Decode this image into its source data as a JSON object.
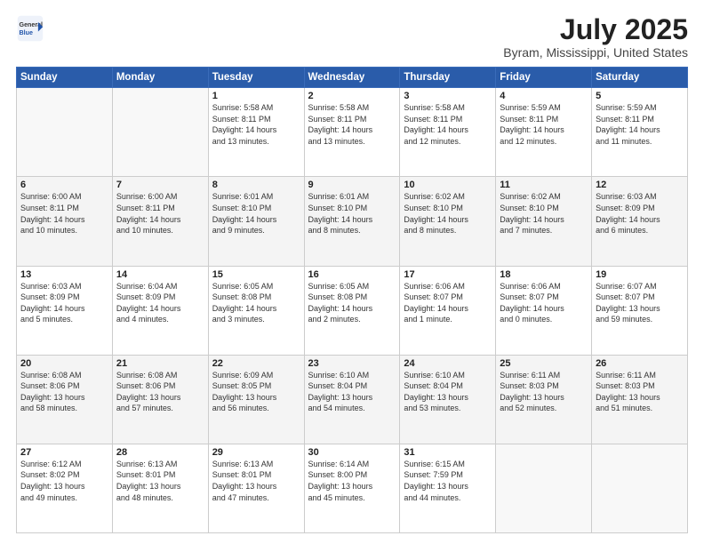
{
  "header": {
    "logo_general": "General",
    "logo_blue": "Blue",
    "month_year": "July 2025",
    "location": "Byram, Mississippi, United States"
  },
  "weekdays": [
    "Sunday",
    "Monday",
    "Tuesday",
    "Wednesday",
    "Thursday",
    "Friday",
    "Saturday"
  ],
  "weeks": [
    [
      {
        "day": "",
        "info": ""
      },
      {
        "day": "",
        "info": ""
      },
      {
        "day": "1",
        "info": "Sunrise: 5:58 AM\nSunset: 8:11 PM\nDaylight: 14 hours\nand 13 minutes."
      },
      {
        "day": "2",
        "info": "Sunrise: 5:58 AM\nSunset: 8:11 PM\nDaylight: 14 hours\nand 13 minutes."
      },
      {
        "day": "3",
        "info": "Sunrise: 5:58 AM\nSunset: 8:11 PM\nDaylight: 14 hours\nand 12 minutes."
      },
      {
        "day": "4",
        "info": "Sunrise: 5:59 AM\nSunset: 8:11 PM\nDaylight: 14 hours\nand 12 minutes."
      },
      {
        "day": "5",
        "info": "Sunrise: 5:59 AM\nSunset: 8:11 PM\nDaylight: 14 hours\nand 11 minutes."
      }
    ],
    [
      {
        "day": "6",
        "info": "Sunrise: 6:00 AM\nSunset: 8:11 PM\nDaylight: 14 hours\nand 10 minutes."
      },
      {
        "day": "7",
        "info": "Sunrise: 6:00 AM\nSunset: 8:11 PM\nDaylight: 14 hours\nand 10 minutes."
      },
      {
        "day": "8",
        "info": "Sunrise: 6:01 AM\nSunset: 8:10 PM\nDaylight: 14 hours\nand 9 minutes."
      },
      {
        "day": "9",
        "info": "Sunrise: 6:01 AM\nSunset: 8:10 PM\nDaylight: 14 hours\nand 8 minutes."
      },
      {
        "day": "10",
        "info": "Sunrise: 6:02 AM\nSunset: 8:10 PM\nDaylight: 14 hours\nand 8 minutes."
      },
      {
        "day": "11",
        "info": "Sunrise: 6:02 AM\nSunset: 8:10 PM\nDaylight: 14 hours\nand 7 minutes."
      },
      {
        "day": "12",
        "info": "Sunrise: 6:03 AM\nSunset: 8:09 PM\nDaylight: 14 hours\nand 6 minutes."
      }
    ],
    [
      {
        "day": "13",
        "info": "Sunrise: 6:03 AM\nSunset: 8:09 PM\nDaylight: 14 hours\nand 5 minutes."
      },
      {
        "day": "14",
        "info": "Sunrise: 6:04 AM\nSunset: 8:09 PM\nDaylight: 14 hours\nand 4 minutes."
      },
      {
        "day": "15",
        "info": "Sunrise: 6:05 AM\nSunset: 8:08 PM\nDaylight: 14 hours\nand 3 minutes."
      },
      {
        "day": "16",
        "info": "Sunrise: 6:05 AM\nSunset: 8:08 PM\nDaylight: 14 hours\nand 2 minutes."
      },
      {
        "day": "17",
        "info": "Sunrise: 6:06 AM\nSunset: 8:07 PM\nDaylight: 14 hours\nand 1 minute."
      },
      {
        "day": "18",
        "info": "Sunrise: 6:06 AM\nSunset: 8:07 PM\nDaylight: 14 hours\nand 0 minutes."
      },
      {
        "day": "19",
        "info": "Sunrise: 6:07 AM\nSunset: 8:07 PM\nDaylight: 13 hours\nand 59 minutes."
      }
    ],
    [
      {
        "day": "20",
        "info": "Sunrise: 6:08 AM\nSunset: 8:06 PM\nDaylight: 13 hours\nand 58 minutes."
      },
      {
        "day": "21",
        "info": "Sunrise: 6:08 AM\nSunset: 8:06 PM\nDaylight: 13 hours\nand 57 minutes."
      },
      {
        "day": "22",
        "info": "Sunrise: 6:09 AM\nSunset: 8:05 PM\nDaylight: 13 hours\nand 56 minutes."
      },
      {
        "day": "23",
        "info": "Sunrise: 6:10 AM\nSunset: 8:04 PM\nDaylight: 13 hours\nand 54 minutes."
      },
      {
        "day": "24",
        "info": "Sunrise: 6:10 AM\nSunset: 8:04 PM\nDaylight: 13 hours\nand 53 minutes."
      },
      {
        "day": "25",
        "info": "Sunrise: 6:11 AM\nSunset: 8:03 PM\nDaylight: 13 hours\nand 52 minutes."
      },
      {
        "day": "26",
        "info": "Sunrise: 6:11 AM\nSunset: 8:03 PM\nDaylight: 13 hours\nand 51 minutes."
      }
    ],
    [
      {
        "day": "27",
        "info": "Sunrise: 6:12 AM\nSunset: 8:02 PM\nDaylight: 13 hours\nand 49 minutes."
      },
      {
        "day": "28",
        "info": "Sunrise: 6:13 AM\nSunset: 8:01 PM\nDaylight: 13 hours\nand 48 minutes."
      },
      {
        "day": "29",
        "info": "Sunrise: 6:13 AM\nSunset: 8:01 PM\nDaylight: 13 hours\nand 47 minutes."
      },
      {
        "day": "30",
        "info": "Sunrise: 6:14 AM\nSunset: 8:00 PM\nDaylight: 13 hours\nand 45 minutes."
      },
      {
        "day": "31",
        "info": "Sunrise: 6:15 AM\nSunset: 7:59 PM\nDaylight: 13 hours\nand 44 minutes."
      },
      {
        "day": "",
        "info": ""
      },
      {
        "day": "",
        "info": ""
      }
    ]
  ]
}
